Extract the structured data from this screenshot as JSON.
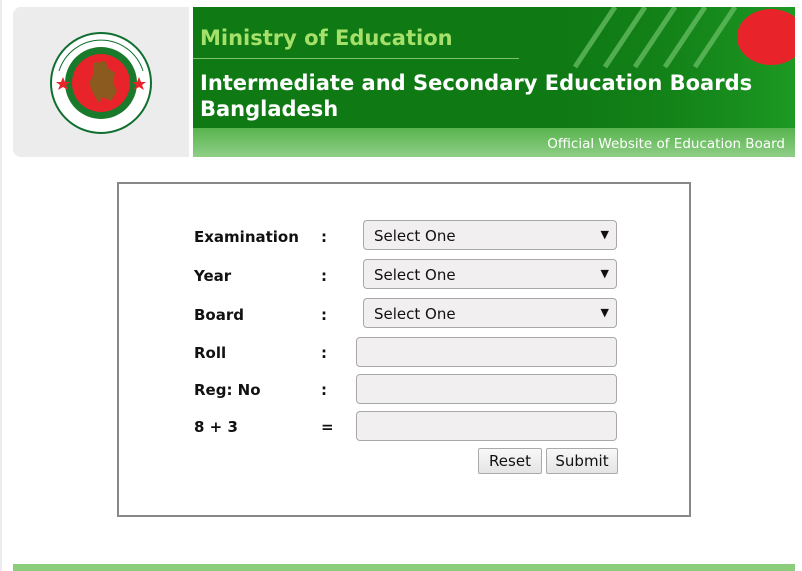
{
  "header": {
    "ministry": "Ministry of Education",
    "boards_title": "Intermediate and Secondary Education Boards Bangladesh",
    "official": "Official Website of Education Board"
  },
  "form": {
    "fields": [
      {
        "label": "Examination",
        "sep": ":",
        "type": "select",
        "value": "Select One"
      },
      {
        "label": "Year",
        "sep": ":",
        "type": "select",
        "value": "Select One"
      },
      {
        "label": "Board",
        "sep": ":",
        "type": "select",
        "value": "Select One"
      },
      {
        "label": "Roll",
        "sep": ":",
        "type": "text",
        "value": ""
      },
      {
        "label": "Reg: No",
        "sep": ":",
        "type": "text",
        "value": ""
      },
      {
        "label": "8 + 3",
        "sep": "=",
        "type": "text",
        "value": ""
      }
    ],
    "reset_label": "Reset",
    "submit_label": "Submit",
    "arrow_glyph": "▼"
  },
  "colors": {
    "banner_green": "#0f7a14",
    "ministry_text": "#a5e06a",
    "subbar_green": "#6cbf60",
    "footer_green": "#8ccd7c"
  }
}
